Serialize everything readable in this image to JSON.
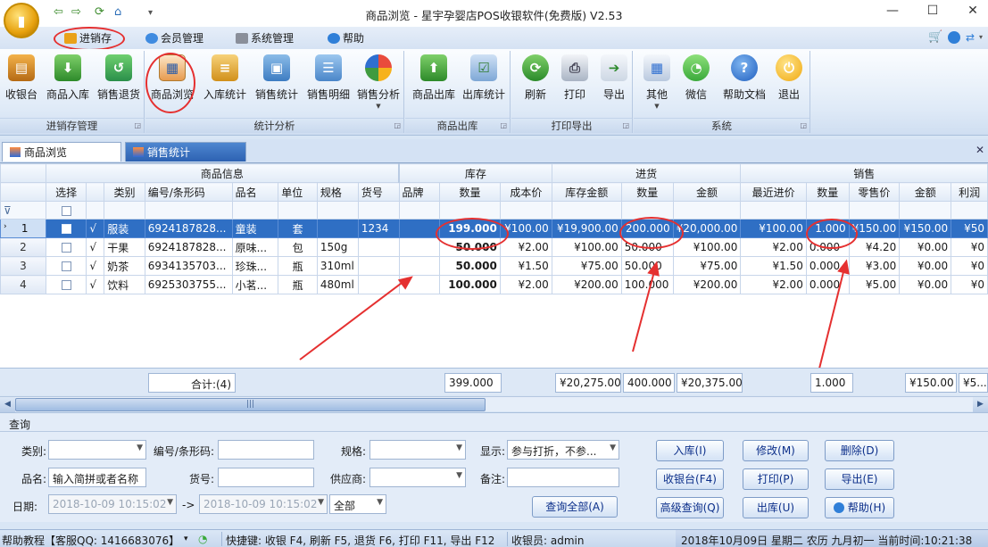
{
  "window": {
    "title": "商品浏览 - 星宇孕婴店POS收银软件(免费版) V2.53"
  },
  "menu": {
    "items": [
      "进销存",
      "会员管理",
      "系统管理",
      "帮助"
    ]
  },
  "ribbon": {
    "groups": [
      {
        "caption": "进销存管理",
        "buttons": [
          "收银台",
          "商品入库",
          "销售退货"
        ]
      },
      {
        "caption": "统计分析",
        "buttons": [
          "商品浏览",
          "入库统计",
          "销售统计",
          "销售明细",
          "销售分析"
        ]
      },
      {
        "caption": "商品出库",
        "buttons": [
          "商品出库",
          "出库统计"
        ]
      },
      {
        "caption": "打印导出",
        "buttons": [
          "刷新",
          "打印",
          "导出"
        ]
      },
      {
        "caption": "系统",
        "buttons": [
          "其他",
          "微信",
          "帮助文档",
          "退出"
        ]
      }
    ]
  },
  "tabs": [
    "商品浏览",
    "销售统计"
  ],
  "grid": {
    "bands": [
      "商品信息",
      "库存",
      "进货",
      "销售"
    ],
    "columns": [
      "选择",
      "类别",
      "编号/条形码",
      "品名",
      "单位",
      "规格",
      "货号",
      "品牌",
      "数量",
      "成本价",
      "库存金额",
      "数量",
      "金额",
      "最近进价",
      "数量",
      "零售价",
      "金额",
      "利润"
    ],
    "rows": [
      {
        "rn": "1",
        "mark": "√",
        "cat": "服装",
        "code": "6924187828...",
        "name": "童装",
        "unit": "套",
        "spec": "",
        "sku": "1234",
        "brand": "",
        "stock_qty": "199.000",
        "cost": "¥100.00",
        "stock_amt": "¥19,900.00",
        "in_qty": "200.000",
        "in_amt": "¥20,000.00",
        "last_price": "¥100.00",
        "sale_qty": "1.000",
        "retail": "¥150.00",
        "sale_amt": "¥150.00",
        "profit": "¥50"
      },
      {
        "rn": "2",
        "mark": "√",
        "cat": "干果",
        "code": "6924187828...",
        "name": "原味...",
        "unit": "包",
        "spec": "150g",
        "sku": "",
        "brand": "",
        "stock_qty": "50.000",
        "cost": "¥2.00",
        "stock_amt": "¥100.00",
        "in_qty": "50.000",
        "in_amt": "¥100.00",
        "last_price": "¥2.00",
        "sale_qty": "0.000",
        "retail": "¥4.20",
        "sale_amt": "¥0.00",
        "profit": "¥0"
      },
      {
        "rn": "3",
        "mark": "√",
        "cat": "奶茶",
        "code": "6934135703...",
        "name": "珍珠...",
        "unit": "瓶",
        "spec": "310ml",
        "sku": "",
        "brand": "",
        "stock_qty": "50.000",
        "cost": "¥1.50",
        "stock_amt": "¥75.00",
        "in_qty": "50.000",
        "in_amt": "¥75.00",
        "last_price": "¥1.50",
        "sale_qty": "0.000",
        "retail": "¥3.00",
        "sale_amt": "¥0.00",
        "profit": "¥0"
      },
      {
        "rn": "4",
        "mark": "√",
        "cat": "饮料",
        "code": "6925303755...",
        "name": "小茗...",
        "unit": "瓶",
        "spec": "480ml",
        "sku": "",
        "brand": "",
        "stock_qty": "100.000",
        "cost": "¥2.00",
        "stock_amt": "¥200.00",
        "in_qty": "100.000",
        "in_amt": "¥200.00",
        "last_price": "¥2.00",
        "sale_qty": "0.000",
        "retail": "¥5.00",
        "sale_amt": "¥0.00",
        "profit": "¥0"
      }
    ]
  },
  "summary": {
    "count": "合计:(4)",
    "stock_qty": "399.000",
    "stock_amt": "¥20,275.00",
    "in_qty": "400.000",
    "in_amt": "¥20,375.00",
    "sale_qty": "1.000",
    "sale_amt": "¥150.00",
    "profit": "¥5..."
  },
  "query": {
    "title": "查询",
    "labels": {
      "category": "类别:",
      "code": "编号/条形码:",
      "spec": "规格:",
      "display": "显示:",
      "name": "品名:",
      "sku": "货号:",
      "supplier": "供应商:",
      "remark": "备注:",
      "date": "日期:"
    },
    "name_placeholder": "输入简拼或者名称",
    "display_value": "参与打折，不参...",
    "date_from": "2018-10-09 10:15:02",
    "date_to": "2018-10-09 10:15:02",
    "date_sep": "->",
    "range_value": "全部",
    "buttons": {
      "query_all": "查询全部(A)",
      "stock_in": "入库(I)",
      "modify": "修改(M)",
      "delete": "删除(D)",
      "pos": "收银台(F4)",
      "print": "打印(P)",
      "export": "导出(E)",
      "advanced": "高级查询(Q)",
      "stock_out": "出库(U)",
      "help": "帮助(H)"
    }
  },
  "status": {
    "help": "帮助教程【客服QQ: 1416683076】",
    "shortcuts": "快捷键: 收银 F4, 刷新 F5, 退货 F6, 打印 F11, 导出 F12",
    "cashier": "收银员: admin",
    "datetime": "2018年10月09日 星期二 农历 九月初一 当前时间:10:21:38"
  }
}
